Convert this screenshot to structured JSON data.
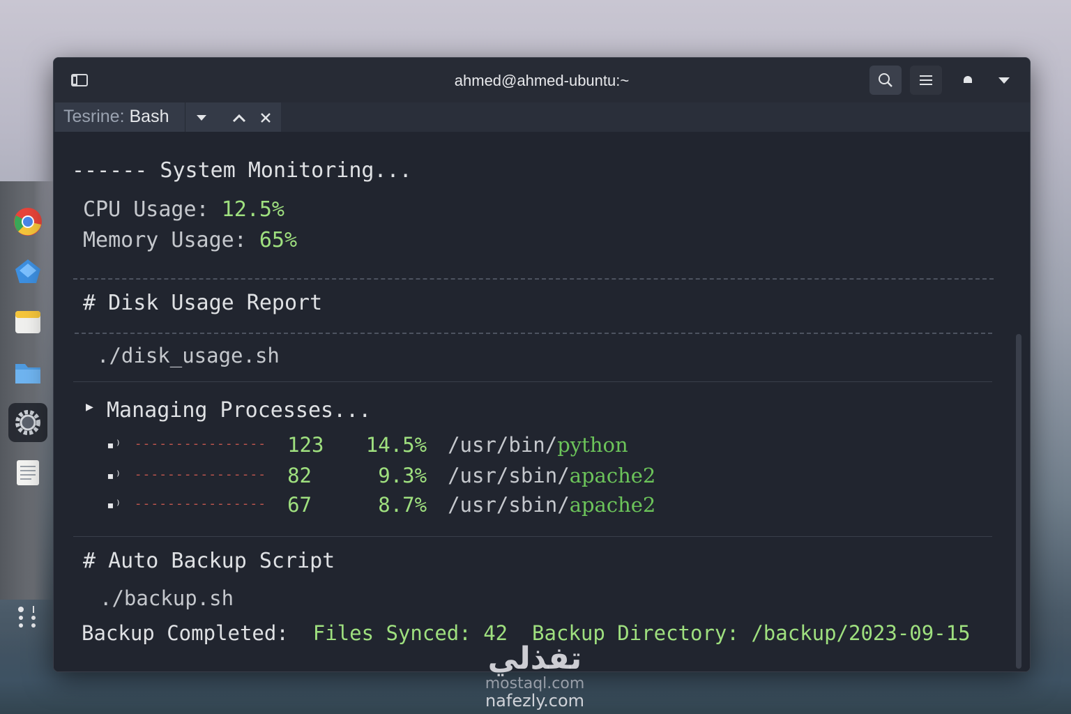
{
  "window": {
    "title": "ahmed@ahmed-ubuntu:~"
  },
  "tab": {
    "prefix": "Tesrine: ",
    "name": "Bash"
  },
  "terminal": {
    "monitor_header": "------ System Monitoring...",
    "cpu_label": "CPU Usage: ",
    "cpu_value": "12.5%",
    "mem_label": "Memory Usage: ",
    "mem_value": "65%",
    "disk_header": "# Disk Usage Report",
    "disk_cmd": "./disk_usage.sh",
    "proc_header": "Managing Processes...",
    "processes": [
      {
        "pid": "123",
        "cpu": "14.5%",
        "path": "/usr/bin/",
        "name": "python"
      },
      {
        "pid": "82",
        "cpu": "9.3%",
        "path": "/usr/sbin/",
        "name": "apache2"
      },
      {
        "pid": "67",
        "cpu": "8.7%",
        "path": "/usr/sbin/",
        "name": "apache2"
      }
    ],
    "proc_dashes": "----------------",
    "backup_header": "# Auto Backup Script",
    "backup_cmd": "./backup.sh",
    "backup_done_label": "Backup Completed:",
    "files_synced_label": "Files Synced:",
    "files_synced_value": "42",
    "backup_dir_label": "Backup Directory:",
    "backup_dir_value": "/backup/2023-09-15"
  },
  "watermark": {
    "arabic": "تفذلي",
    "line1": "mostaql.com",
    "line2": "nafezly.com"
  },
  "colors": {
    "accent_green": "#9fe07f",
    "terminal_bg": "#21252f"
  }
}
